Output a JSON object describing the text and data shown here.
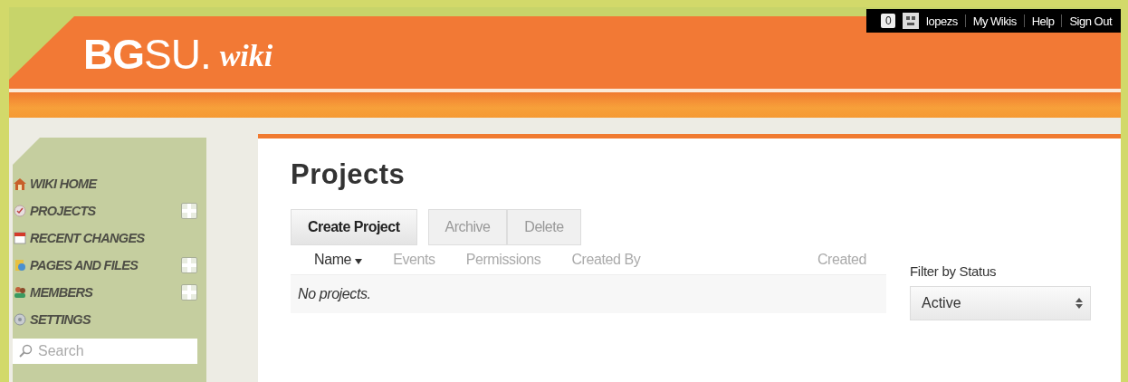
{
  "header": {
    "logo": "**BG**SU.",
    "logo_suffix": "wiki",
    "notifications": "0",
    "user": "lopezs",
    "links": [
      "My Wikis",
      "Help",
      "Sign Out"
    ]
  },
  "sidebar": {
    "items": [
      {
        "label": "WIKI HOME",
        "kind": "home",
        "addable": false
      },
      {
        "label": "PROJECTS",
        "kind": "projects",
        "addable": true
      },
      {
        "label": "RECENT CHANGES",
        "kind": "calendar",
        "addable": false
      },
      {
        "label": "PAGES AND FILES",
        "kind": "pages",
        "addable": true
      },
      {
        "label": "MEMBERS",
        "kind": "members",
        "addable": true
      },
      {
        "label": "SETTINGS",
        "kind": "settings",
        "addable": false
      }
    ],
    "search": {
      "placeholder": "Search"
    }
  },
  "main": {
    "title": "Projects",
    "buttons": [
      {
        "label": "Create Project",
        "disabled": false
      },
      {
        "label": "Archive",
        "disabled": true
      },
      {
        "label": "Delete",
        "disabled": true
      }
    ],
    "table": {
      "columns": [
        {
          "label": "Name",
          "sorted": true
        },
        {
          "label": "Events",
          "sorted": false
        },
        {
          "label": "Permissions",
          "sorted": false
        },
        {
          "label": "Created By",
          "sorted": false
        },
        {
          "label": "Created",
          "sorted": false
        }
      ],
      "empty_message": "No projects."
    },
    "filter": {
      "label": "Filter by Status",
      "value": "Active"
    }
  }
}
